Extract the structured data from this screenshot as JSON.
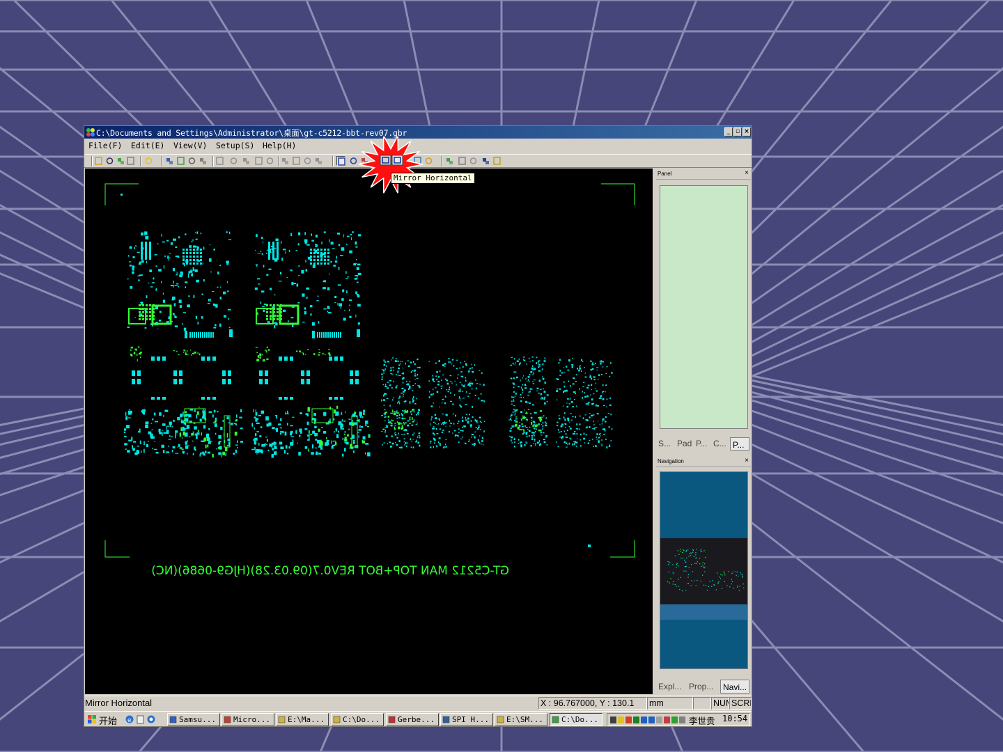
{
  "window": {
    "title": "C:\\Documents and Settings\\Administrator\\桌面\\gt-c5212-bbt-rev07.gbr",
    "minimize_label": "_",
    "restore_label": "▫",
    "close_label": "×"
  },
  "menu": {
    "file": "File(F)",
    "edit": "Edit(E)",
    "view": "View(V)",
    "setup": "Setup(S)",
    "help": "Help(H)"
  },
  "tooltip": "Mirror Horizontal",
  "canvas": {
    "board_label": "GT-C5212 MAN TOP+BOT REV0.7(09.03.28)(HJG9-0686)(NC)",
    "background": "#000000",
    "pad_color": "#00e5e5",
    "outline_color": "#33ff33"
  },
  "panel": {
    "title": "Panel",
    "close": "×",
    "tabs": [
      "S...",
      "Pad",
      "P...",
      "C...",
      "P..."
    ],
    "active_tab": "P...",
    "fill_color": "#c8e8c8"
  },
  "navigation": {
    "title": "Navigation",
    "close": "×",
    "tabs": [
      "Expl...",
      "Prop...",
      "Navi..."
    ],
    "active_tab": "Navi...",
    "fill_color": "#0a5880"
  },
  "status": {
    "message": "Mirror Horizontal",
    "coords": "X : 96.767000, Y : 130.1",
    "unit": "mm",
    "num": "NUM",
    "scrl": "SCRL"
  },
  "taskbar": {
    "start": "开始",
    "tasks": [
      "Samsu...",
      "Micro...",
      "E:\\Ma...",
      "C:\\Do...",
      "Gerbe...",
      "SPI H...",
      "E:\\SM...",
      "C:\\Do..."
    ],
    "active_task": 7,
    "user": "李世贵",
    "clock": "10:54"
  }
}
